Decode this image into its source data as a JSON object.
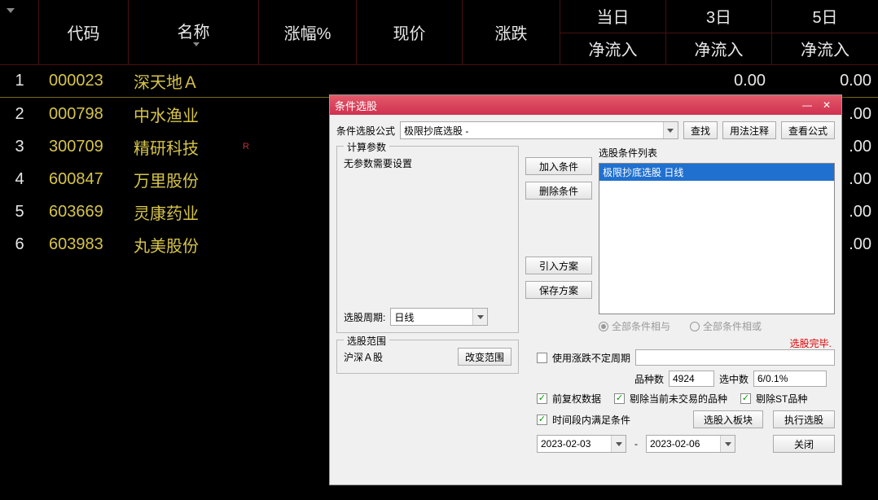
{
  "table": {
    "headers": {
      "code": "代码",
      "name": "名称",
      "pct": "涨幅%",
      "price": "现价",
      "chg": "涨跌",
      "d1": "当日",
      "d3": "3日",
      "d5": "5日",
      "netflow": "净流入"
    },
    "rows": [
      {
        "idx": "1",
        "code": "000023",
        "name": "深天地Ａ",
        "marker": "",
        "d3": "0.00",
        "d5": "0.00"
      },
      {
        "idx": "2",
        "code": "000798",
        "name": "中水渔业",
        "marker": "",
        "d5": ".00"
      },
      {
        "idx": "3",
        "code": "300709",
        "name": "精研科技",
        "marker": "R",
        "d5": ".00"
      },
      {
        "idx": "4",
        "code": "600847",
        "name": "万里股份",
        "marker": "",
        "d5": ".00"
      },
      {
        "idx": "5",
        "code": "603669",
        "name": "灵康药业",
        "marker": "",
        "d5": ".00"
      },
      {
        "idx": "6",
        "code": "603983",
        "name": "丸美股份",
        "marker": "",
        "d5": ".00"
      }
    ]
  },
  "dialog": {
    "title": "条件选股",
    "formulaLabel": "条件选股公式",
    "formulaValue": "极限抄底选股 -",
    "btnFind": "查找",
    "btnUsage": "用法注释",
    "btnViewFormula": "查看公式",
    "calcLegend": "计算参数",
    "calcText": "无参数需要设置",
    "periodLabel": "选股周期:",
    "periodValue": "日线",
    "btnAddCond": "加入条件",
    "btnDelCond": "删除条件",
    "btnImport": "引入方案",
    "btnSave": "保存方案",
    "listLabel": "选股条件列表",
    "listItem": "极限抄底选股  日线",
    "radioAnd": "全部条件相与",
    "radioOr": "全部条件相或",
    "rangeLegend": "选股范围",
    "rangeText": "沪深Ａ股",
    "btnChangeRange": "改变范围",
    "statusText": "选股完毕.",
    "chkVarPeriod": "使用涨跌不定周期",
    "varPeriodValue": "",
    "countLabel": "品种数",
    "countValue": "4924",
    "selLabel": "选中数",
    "selValue": "6/0.1%",
    "chkForward": "前复权数据",
    "chkExcludeNoTrade": "剔除当前未交易的品种",
    "chkExcludeST": "剔除ST品种",
    "chkTimeRange": "时间段内满足条件",
    "btnToBlock": "选股入板块",
    "btnExecute": "执行选股",
    "dateFrom": "2023-02-03",
    "dateTo": "2023-02-06",
    "btnClose": "关闭"
  }
}
